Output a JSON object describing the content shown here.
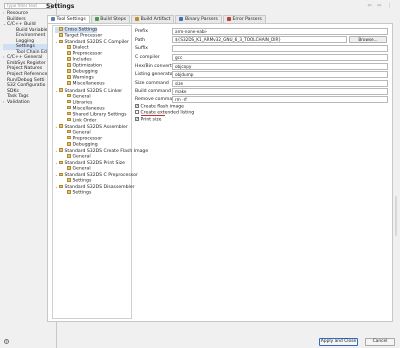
{
  "left_nav": {
    "filter_placeholder": "type filter text",
    "items": [
      {
        "label": "Resource",
        "expander": "›",
        "indent": 0
      },
      {
        "label": "Builders",
        "expander": "",
        "indent": 0
      },
      {
        "label": "C/C++ Build",
        "expander": "⌄",
        "indent": 0
      },
      {
        "label": "Build Variables",
        "expander": "",
        "indent": 1
      },
      {
        "label": "Environment",
        "expander": "",
        "indent": 1
      },
      {
        "label": "Logging",
        "expander": "",
        "indent": 1
      },
      {
        "label": "Settings",
        "expander": "",
        "indent": 1,
        "selected": true
      },
      {
        "label": "Tool Chain Edi",
        "expander": "",
        "indent": 1
      },
      {
        "label": "C/C++ General",
        "expander": "›",
        "indent": 0
      },
      {
        "label": "EmbSys Register",
        "expander": "",
        "indent": 0
      },
      {
        "label": "Project Natures",
        "expander": "",
        "indent": 0
      },
      {
        "label": "Project Reference",
        "expander": "",
        "indent": 0
      },
      {
        "label": "Run/Debug Setti",
        "expander": "",
        "indent": 0
      },
      {
        "label": "S32 Configuratio",
        "expander": "",
        "indent": 0
      },
      {
        "label": "SDKs",
        "expander": "",
        "indent": 0
      },
      {
        "label": "Task Tags",
        "expander": "",
        "indent": 0
      },
      {
        "label": "Validation",
        "expander": "›",
        "indent": 0
      }
    ]
  },
  "header": {
    "title": "Settings",
    "icons": "⇦ ⇨ ⋮"
  },
  "tabs": [
    {
      "label": "Tool Settings",
      "color": "#5a7fb0",
      "selected": true
    },
    {
      "label": "Build Steps",
      "color": "#4a9a4a"
    },
    {
      "label": "Build Artifact",
      "color": "#c08a2a"
    },
    {
      "label": "Binary Parsers",
      "color": "#3a6fc0"
    },
    {
      "label": "Error Parsers",
      "color": "#c03a3a"
    }
  ],
  "tree": [
    {
      "label": "Cross Settings",
      "indent": 0,
      "toggle": "",
      "selected": true
    },
    {
      "label": "Target Processor",
      "indent": 0,
      "toggle": ""
    },
    {
      "label": "Standard S32DS C Compiler",
      "indent": 0,
      "toggle": "⌄"
    },
    {
      "label": "Dialect",
      "indent": 1,
      "toggle": ""
    },
    {
      "label": "Preprocessor",
      "indent": 1,
      "toggle": ""
    },
    {
      "label": "Includes",
      "indent": 1,
      "toggle": ""
    },
    {
      "label": "Optimization",
      "indent": 1,
      "toggle": ""
    },
    {
      "label": "Debugging",
      "indent": 1,
      "toggle": ""
    },
    {
      "label": "Warnings",
      "indent": 1,
      "toggle": ""
    },
    {
      "label": "Miscellaneous",
      "indent": 1,
      "toggle": ""
    },
    {
      "label": "Standard S32DS C Linker",
      "indent": 0,
      "toggle": "⌄"
    },
    {
      "label": "General",
      "indent": 1,
      "toggle": ""
    },
    {
      "label": "Libraries",
      "indent": 1,
      "toggle": ""
    },
    {
      "label": "Miscellaneous",
      "indent": 1,
      "toggle": ""
    },
    {
      "label": "Shared Library Settings",
      "indent": 1,
      "toggle": ""
    },
    {
      "label": "Link Order",
      "indent": 1,
      "toggle": ""
    },
    {
      "label": "Standard S32DS Assembler",
      "indent": 0,
      "toggle": "⌄"
    },
    {
      "label": "General",
      "indent": 1,
      "toggle": ""
    },
    {
      "label": "Preprocessor",
      "indent": 1,
      "toggle": ""
    },
    {
      "label": "Debugging",
      "indent": 1,
      "toggle": ""
    },
    {
      "label": "Standard S32DS Create Flash Image",
      "indent": 0,
      "toggle": "⌄"
    },
    {
      "label": "General",
      "indent": 1,
      "toggle": ""
    },
    {
      "label": "Standard S32DS Print Size",
      "indent": 0,
      "toggle": "⌄"
    },
    {
      "label": "General",
      "indent": 1,
      "toggle": ""
    },
    {
      "label": "Standard S32DS C Preprocessor",
      "indent": 0,
      "toggle": "⌄"
    },
    {
      "label": "Settings",
      "indent": 1,
      "toggle": ""
    },
    {
      "label": "Standard S32DS Disassembler",
      "indent": 0,
      "toggle": "⌄"
    },
    {
      "label": "Settings",
      "indent": 1,
      "toggle": ""
    }
  ],
  "form": {
    "prefix": {
      "label": "Prefix",
      "value": "arm-none-eabi-"
    },
    "path": {
      "label": "Path",
      "value": "${S32DS_K1_ARMv32_GNU_6_3_TOOLCHAIN_DIR}"
    },
    "browse_label": "Browse...",
    "suffix": {
      "label": "Suffix",
      "value": ""
    },
    "c_compiler": {
      "label": "C compiler",
      "value": "gcc"
    },
    "hex_bin": {
      "label": "Hex/Bin converter",
      "value": "objcopy"
    },
    "listing": {
      "label": "Listing generator",
      "value": "objdump"
    },
    "size": {
      "label": "Size command",
      "value": "size"
    },
    "build": {
      "label": "Build command",
      "value": "make"
    },
    "remove": {
      "label": "Remove command",
      "value": "rm -rf"
    },
    "checkboxes": [
      {
        "label": "Create flash image",
        "checked": true
      },
      {
        "label": "Create extended listing",
        "checked": false
      },
      {
        "label": "Print size",
        "checked": true
      }
    ]
  },
  "footer": {
    "help_label": "?",
    "apply_close_label": "Apply and Close",
    "cancel_label": "Cancel"
  }
}
